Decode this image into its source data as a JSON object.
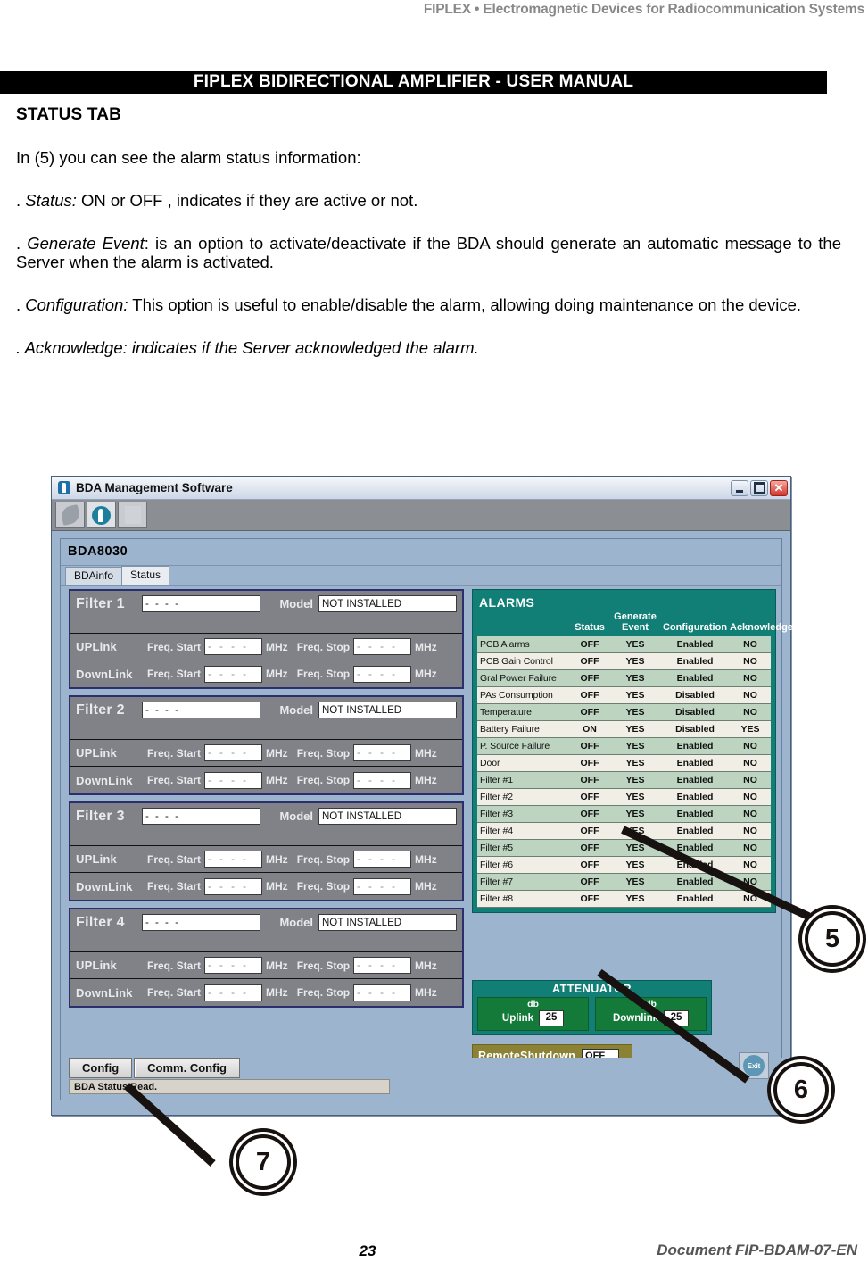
{
  "document": {
    "header_right": "FIPLEX • Electromagnetic Devices for Radiocommunication Systems",
    "banner": "FIPLEX BIDIRECTIONAL AMPLIFIER -  USER MANUAL",
    "section_title": "STATUS TAB",
    "paragraphs": [
      "In (5) you can see the alarm status information:",
      ". Status: ON or OFF , indicates if they are active or not.",
      ". Generate Event: is an option to activate/deactivate if the BDA should generate an automatic message to the Server when the alarm is activated.",
      ". Configuration: This option is useful to enable/disable the alarm, allowing doing maintenance on the device.",
      ". Acknowledge: indicates if the Server acknowledged the alarm."
    ],
    "para_parts": {
      "p2_lead": ". ",
      "p2_em": "Status:",
      "p2_rest": " ON or OFF , indicates if they are active or not.",
      "p3_lead": ". ",
      "p3_em": "Generate Event",
      "p3_rest": ": is an option to activate/deactivate if the BDA should generate an automatic message to the Server when the alarm is activated.",
      "p4_lead": ". ",
      "p4_em": "Configuration:",
      "p4_rest": " This option is useful to enable/disable the alarm, allowing doing maintenance on the device.",
      "p5_all": ". Acknowledge: indicates if the Server acknowledged the alarm."
    },
    "footer_page": "23",
    "footer_doc": "Document FIP-BDAM-07-EN"
  },
  "app": {
    "title": "BDA Management Software",
    "titlebar_icon": "app-logo-icon",
    "window_buttons": [
      {
        "name": "minimize-button",
        "glyph": "–"
      },
      {
        "name": "maximize-button",
        "glyph": "❐"
      },
      {
        "name": "close-button",
        "glyph": "✕"
      }
    ],
    "toolbar": [
      {
        "name": "feather-tool-icon",
        "selected": false
      },
      {
        "name": "connect-tool-icon",
        "selected": true
      },
      {
        "name": "blank-tool-icon",
        "selected": false
      }
    ],
    "groupbox_title": "BDA8030",
    "tabs": [
      {
        "label": "BDAinfo",
        "active": false
      },
      {
        "label": "Status",
        "active": true
      }
    ],
    "filters": [
      {
        "name": "Filter 1",
        "name_value": "- - - -",
        "model_label": "Model",
        "model_value": "NOT INSTALLED",
        "rows": [
          {
            "link": "UPLink",
            "start_label": "Freq. Start",
            "start_value": "- - - -",
            "stop_label": "Freq. Stop",
            "stop_value": "- - - -",
            "unit": "MHz"
          },
          {
            "link": "DownLink",
            "start_label": "Freq. Start",
            "start_value": "- - - -",
            "stop_label": "Freq. Stop",
            "stop_value": "- - - -",
            "unit": "MHz"
          }
        ]
      },
      {
        "name": "Filter 2",
        "name_value": "- - - -",
        "model_label": "Model",
        "model_value": "NOT INSTALLED",
        "rows": [
          {
            "link": "UPLink",
            "start_label": "Freq. Start",
            "start_value": "- - - -",
            "stop_label": "Freq. Stop",
            "stop_value": "- - - -",
            "unit": "MHz"
          },
          {
            "link": "DownLink",
            "start_label": "Freq. Start",
            "start_value": "- - - -",
            "stop_label": "Freq. Stop",
            "stop_value": "- - - -",
            "unit": "MHz"
          }
        ]
      },
      {
        "name": "Filter 3",
        "name_value": "- - - -",
        "model_label": "Model",
        "model_value": "NOT INSTALLED",
        "rows": [
          {
            "link": "UPLink",
            "start_label": "Freq. Start",
            "start_value": "- - - -",
            "stop_label": "Freq. Stop",
            "stop_value": "- - - -",
            "unit": "MHz"
          },
          {
            "link": "DownLink",
            "start_label": "Freq. Start",
            "start_value": "- - - -",
            "stop_label": "Freq. Stop",
            "stop_value": "- - - -",
            "unit": "MHz"
          }
        ]
      },
      {
        "name": "Filter 4",
        "name_value": "- - - -",
        "model_label": "Model",
        "model_value": "NOT INSTALLED",
        "rows": [
          {
            "link": "UPLink",
            "start_label": "Freq. Start",
            "start_value": "- - - -",
            "stop_label": "Freq. Stop",
            "stop_value": "- - - -",
            "unit": "MHz"
          },
          {
            "link": "DownLink",
            "start_label": "Freq. Start",
            "start_value": "- - - -",
            "stop_label": "Freq. Stop",
            "stop_value": "- - - -",
            "unit": "MHz"
          }
        ]
      }
    ],
    "alarms": {
      "title": "ALARMS",
      "columns": [
        "",
        "Status",
        "Generate Event",
        "Configuration",
        "Acknowledge"
      ],
      "col_status": "Status",
      "col_generate_l1": "Generate",
      "col_generate_l2": "Event",
      "col_config": "Configuration",
      "col_ack": "Acknowledge",
      "rows": [
        {
          "name": "PCB Alarms",
          "status": "OFF",
          "generate": "YES",
          "config": "Enabled",
          "ack": "NO"
        },
        {
          "name": "PCB Gain Control",
          "status": "OFF",
          "generate": "YES",
          "config": "Enabled",
          "ack": "NO"
        },
        {
          "name": "Gral Power Failure",
          "status": "OFF",
          "generate": "YES",
          "config": "Enabled",
          "ack": "NO"
        },
        {
          "name": "PAs Consumption",
          "status": "OFF",
          "generate": "YES",
          "config": "Disabled",
          "ack": "NO"
        },
        {
          "name": "Temperature",
          "status": "OFF",
          "generate": "YES",
          "config": "Disabled",
          "ack": "NO"
        },
        {
          "name": "Battery Failure",
          "status": "ON",
          "generate": "YES",
          "config": "Disabled",
          "ack": "YES"
        },
        {
          "name": "P. Source Failure",
          "status": "OFF",
          "generate": "YES",
          "config": "Enabled",
          "ack": "NO"
        },
        {
          "name": "Door",
          "status": "OFF",
          "generate": "YES",
          "config": "Enabled",
          "ack": "NO"
        },
        {
          "name": "Filter #1",
          "status": "OFF",
          "generate": "YES",
          "config": "Enabled",
          "ack": "NO"
        },
        {
          "name": "Filter #2",
          "status": "OFF",
          "generate": "YES",
          "config": "Enabled",
          "ack": "NO"
        },
        {
          "name": "Filter #3",
          "status": "OFF",
          "generate": "YES",
          "config": "Enabled",
          "ack": "NO"
        },
        {
          "name": "Filter #4",
          "status": "OFF",
          "generate": "YES",
          "config": "Enabled",
          "ack": "NO"
        },
        {
          "name": "Filter #5",
          "status": "OFF",
          "generate": "YES",
          "config": "Enabled",
          "ack": "NO"
        },
        {
          "name": "Filter #6",
          "status": "OFF",
          "generate": "YES",
          "config": "Enabled",
          "ack": "NO"
        },
        {
          "name": "Filter #7",
          "status": "OFF",
          "generate": "YES",
          "config": "Enabled",
          "ack": "NO"
        },
        {
          "name": "Filter #8",
          "status": "OFF",
          "generate": "YES",
          "config": "Enabled",
          "ack": "NO"
        }
      ]
    },
    "attenuator": {
      "title": "ATTENUATOR",
      "uplink": {
        "unit": "db",
        "label": "Uplink",
        "value": "25"
      },
      "downlink": {
        "unit": "db",
        "label": "Downlink",
        "value": "25"
      }
    },
    "remote_shutdown": {
      "label": "RemoteShutdown",
      "value": "OFF"
    },
    "buttons": {
      "config": "Config",
      "comm_config": "Comm. Config",
      "exit": "Exit"
    },
    "status_bar": "BDA Status Read."
  },
  "callouts": [
    {
      "number": "5"
    },
    {
      "number": "6"
    },
    {
      "number": "7"
    }
  ],
  "colors": {
    "window_bg": "#9cb4ce",
    "teal_panel": "#117f75",
    "green_panel": "#137a3a",
    "olive_panel": "#8c8236",
    "filter_panel": "#808287",
    "filter_border": "#2b2f6e",
    "row_odd": "#bdd4c1",
    "row_even": "#f1efe5"
  }
}
